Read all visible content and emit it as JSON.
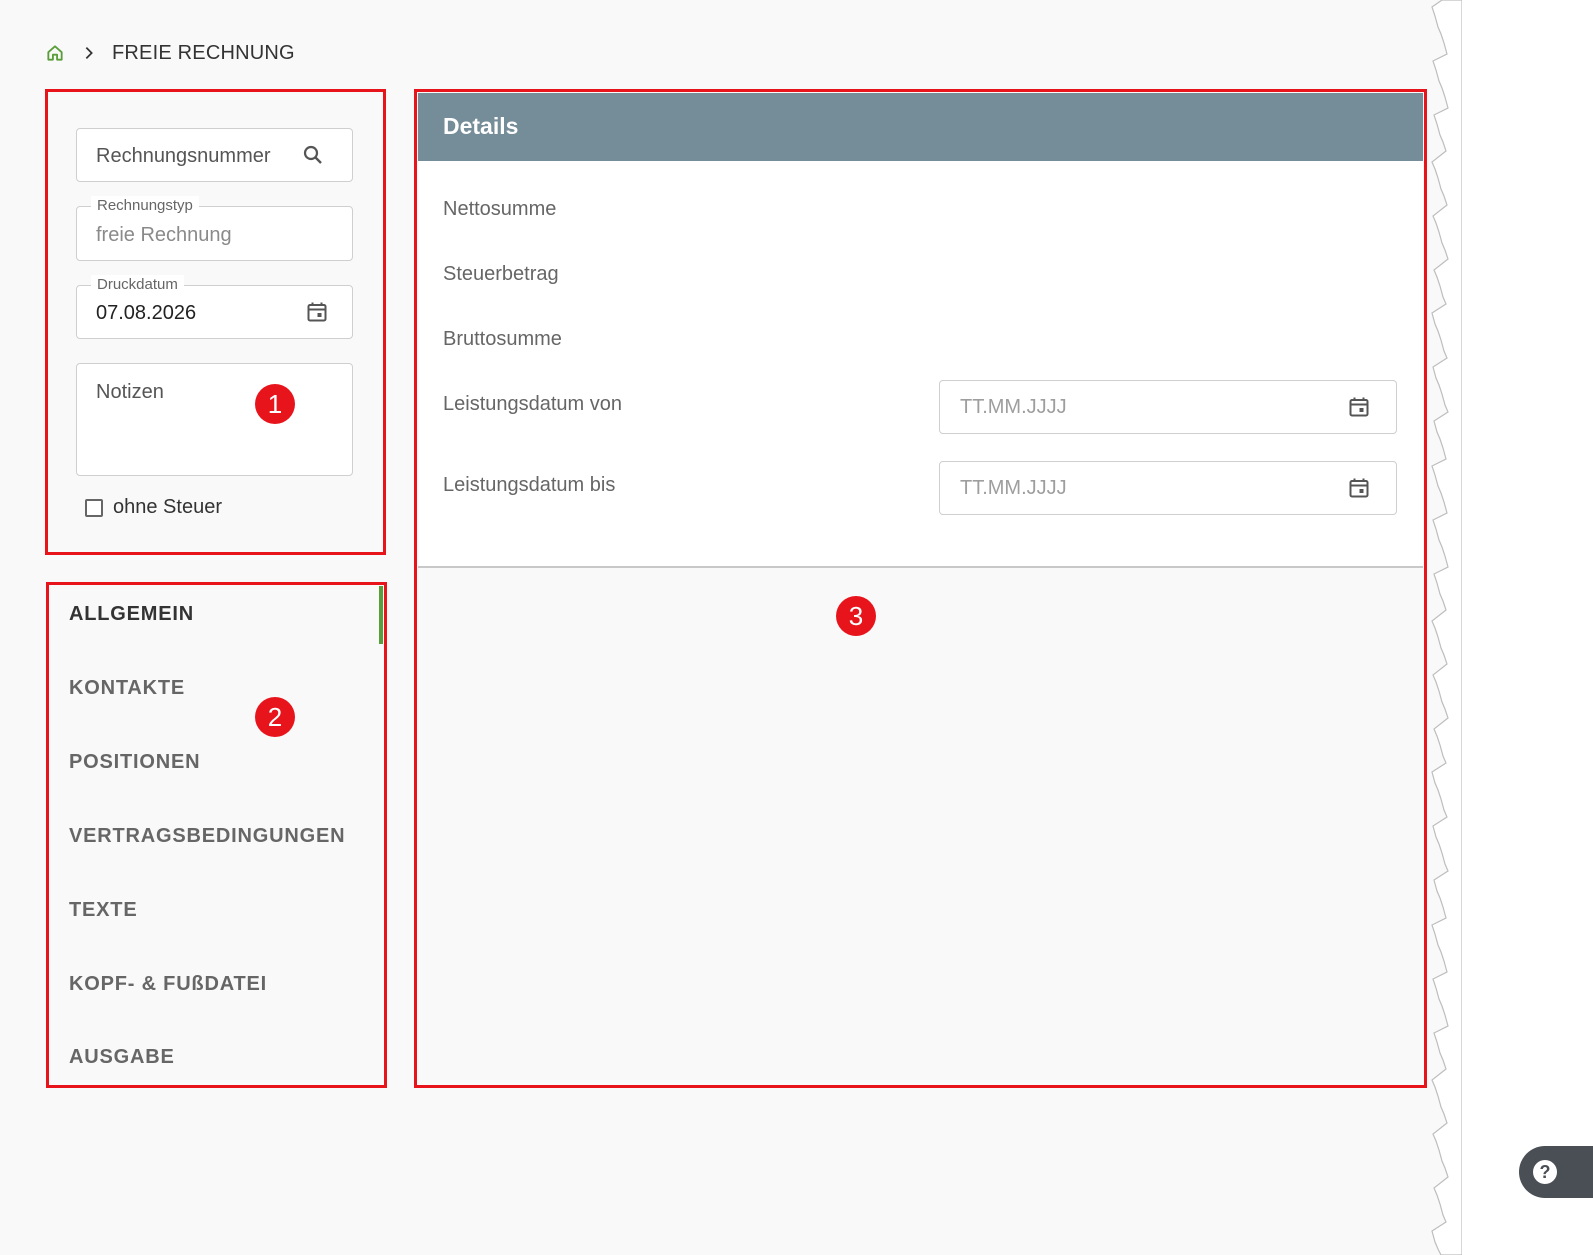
{
  "breadcrumb": {
    "home_icon": "home-icon",
    "separator_icon": "chevron-right-icon",
    "current": "FREIE RECHNUNG"
  },
  "form": {
    "invoice_number": {
      "placeholder": "Rechnungsnummer",
      "icon": "search-icon"
    },
    "invoice_type": {
      "label": "Rechnungstyp",
      "value": "freie Rechnung"
    },
    "print_date": {
      "label": "Druckdatum",
      "value": "07.08.2026",
      "icon": "calendar-icon"
    },
    "notes": {
      "placeholder": "Notizen"
    },
    "no_tax": {
      "label": "ohne Steuer",
      "checked": false
    }
  },
  "tabs": [
    {
      "label": "ALLGEMEIN",
      "active": true
    },
    {
      "label": "KONTAKTE",
      "active": false
    },
    {
      "label": "POSITIONEN",
      "active": false
    },
    {
      "label": "VERTRAGSBEDINGUNGEN",
      "active": false
    },
    {
      "label": "TEXTE",
      "active": false
    },
    {
      "label": "KOPF- & FUßDATEI",
      "active": false
    },
    {
      "label": "AUSGABE",
      "active": false
    }
  ],
  "details": {
    "title": "Details",
    "net_total_label": "Nettosumme",
    "tax_amount_label": "Steuerbetrag",
    "gross_total_label": "Bruttosumme",
    "service_date_from": {
      "label": "Leistungsdatum von",
      "placeholder": "TT.MM.JJJJ",
      "icon": "calendar-icon"
    },
    "service_date_to": {
      "label": "Leistungsdatum bis",
      "placeholder": "TT.MM.JJJJ",
      "icon": "calendar-icon"
    }
  },
  "annotations": {
    "badge_1": "1",
    "badge_2": "2",
    "badge_3": "3"
  },
  "help_icon": "help-icon",
  "colors": {
    "accent_green": "#5a9e3a",
    "header_bg": "#758c99",
    "annotation_red": "#e8141c",
    "help_fab_bg": "#4a4f55"
  }
}
